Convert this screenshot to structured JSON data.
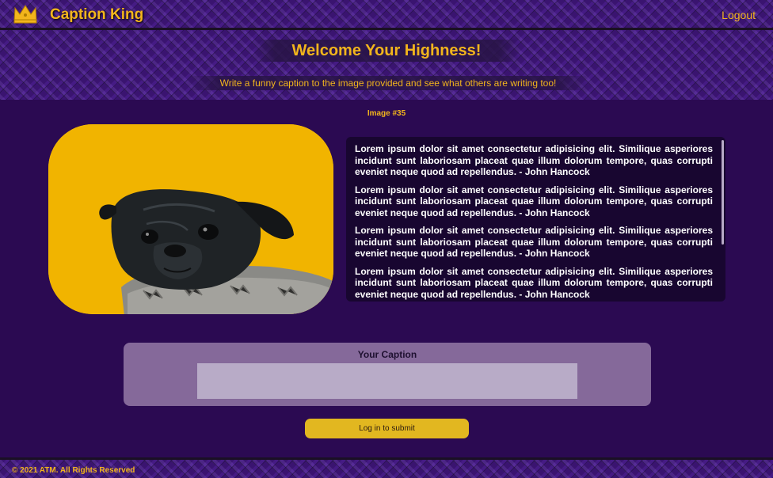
{
  "nav": {
    "brand_name": "Caption King",
    "logo_icon": "crown-icon",
    "logout_label": "Logout"
  },
  "hero": {
    "welcome": "Welcome Your Highness!",
    "subtitle": "Write a funny caption to the image provided and see what others are writing too!"
  },
  "image": {
    "label": "Image #35",
    "subject": "pug-photo",
    "background_color": "#f1b400"
  },
  "captions": [
    {
      "text": "Lorem ipsum dolor sit amet consectetur adipisicing elit. Similique asperiores incidunt sunt laboriosam placeat quae illum dolorum tempore, quas corrupti eveniet neque quod ad repellendus. - John Hancock"
    },
    {
      "text": "Lorem ipsum dolor sit amet consectetur adipisicing elit. Similique asperiores incidunt sunt laboriosam placeat quae illum dolorum tempore, quas corrupti eveniet neque quod ad repellendus. - John Hancock"
    },
    {
      "text": "Lorem ipsum dolor sit amet consectetur adipisicing elit. Similique asperiores incidunt sunt laboriosam placeat quae illum dolorum tempore, quas corrupti eveniet neque quod ad repellendus. - John Hancock"
    },
    {
      "text": "Lorem ipsum dolor sit amet consectetur adipisicing elit. Similique asperiores incidunt sunt laboriosam placeat quae illum dolorum tempore, quas corrupti eveniet neque quod ad repellendus. - John Hancock"
    }
  ],
  "form": {
    "label": "Your Caption",
    "input_value": "",
    "submit_label": "Log in to submit"
  },
  "footer": {
    "copyright": "© 2021 ATM. All Rights Reserved"
  },
  "colors": {
    "accent": "#f2b51c",
    "background": "#2b0a52",
    "form_card": "#85699a",
    "button": "#e2b720"
  }
}
